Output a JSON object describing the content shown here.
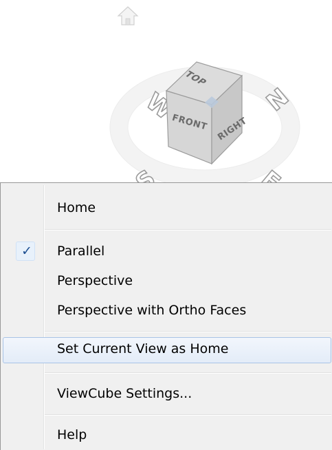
{
  "viewcube": {
    "home_icon": "home-icon",
    "faces": {
      "top": "TOP",
      "front": "FRONT",
      "right": "RIGHT"
    },
    "compass": {
      "west": "W",
      "north": "N",
      "south": "S",
      "east": "E"
    }
  },
  "menu": {
    "items": [
      {
        "label": "Home",
        "checked": false,
        "highlighted": false
      },
      {
        "label": "Parallel",
        "checked": true,
        "highlighted": false
      },
      {
        "label": "Perspective",
        "checked": false,
        "highlighted": false
      },
      {
        "label": "Perspective with Ortho Faces",
        "checked": false,
        "highlighted": false
      },
      {
        "label": "Set Current View as Home",
        "checked": false,
        "highlighted": true
      },
      {
        "label": "ViewCube Settings...",
        "checked": false,
        "highlighted": false
      },
      {
        "label": "Help",
        "checked": false,
        "highlighted": false
      }
    ],
    "check_glyph": "✓",
    "check_icon": "checkmark-icon"
  },
  "colors": {
    "menu_background": "#f0f0f0",
    "menu_border": "#979797",
    "highlight_border": "#a8c3e6",
    "check_color": "#1d4f91"
  }
}
